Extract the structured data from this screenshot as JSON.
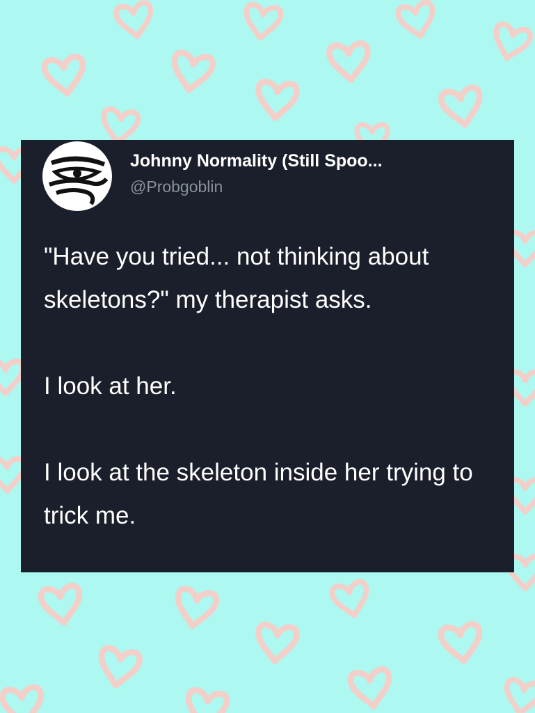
{
  "colors": {
    "background": "#aef8f2",
    "heart_outline": "#f3cfc9",
    "card": "#1b1f2b",
    "handle": "#8a9199"
  },
  "post": {
    "display_name": "Johnny Normality (Still Spoo...",
    "handle": "@Probgoblin",
    "avatar_icon": "eye-of-horus-icon",
    "paragraphs": [
      "\"Have you tried... not thinking about skeletons?\" my therapist asks.",
      "I look at her.",
      "I look at the skeleton inside her trying to trick me."
    ]
  }
}
